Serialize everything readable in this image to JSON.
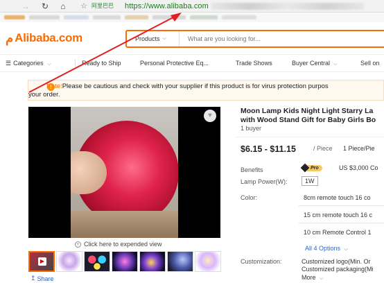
{
  "browser": {
    "secure_label": "阿里巴巴",
    "url": "https://www.alibaba.com"
  },
  "header": {
    "logo_text": "Alibaba.com",
    "search_category": "Products",
    "search_placeholder": "What are you looking for...",
    "brand_color": "#ff6a00"
  },
  "nav": {
    "categories": "Categories",
    "items": [
      "Ready to Ship",
      "Personal Protective Eq...",
      "Trade Shows",
      "Buyer Central",
      "Sell on"
    ]
  },
  "note": {
    "label": "Note:",
    "text": "Please be cautious and check with your supplier if this product is for virus protection purpos",
    "text2": "your order."
  },
  "gallery": {
    "expand_text": "Click here to expended view",
    "share": "Share",
    "thumbnails": [
      "video",
      "moon-lamp",
      "colors",
      "galaxy",
      "galaxy-2",
      "lamp-stand",
      "moon-lamp-2"
    ]
  },
  "product": {
    "title_line1": "Moon Lamp Kids Night Light Starry La",
    "title_line2": "with Wood Stand Gift for Baby Girls Bo",
    "buyers": "1 buyer",
    "price": "$6.15 - $11.15",
    "price_unit": "/ Piece",
    "moq": "1 Piece/Pie",
    "benefits_label": "Benefits",
    "pro_badge": "Pro",
    "benefit_text": "US $3,000 Co",
    "lamp_power_label": "Lamp Power(W):",
    "lamp_power_value": "1W",
    "color_label": "Color:",
    "colors": [
      "8cm remote touch 16 co",
      "15 cm remote touch 16 c",
      "10 cm Remote Control 1"
    ],
    "all_options": "All 4 Options",
    "customization_label": "Customization:",
    "customization": [
      "Customized logo(Min. Or",
      "Customized packaging(Mi"
    ],
    "more": "More"
  }
}
